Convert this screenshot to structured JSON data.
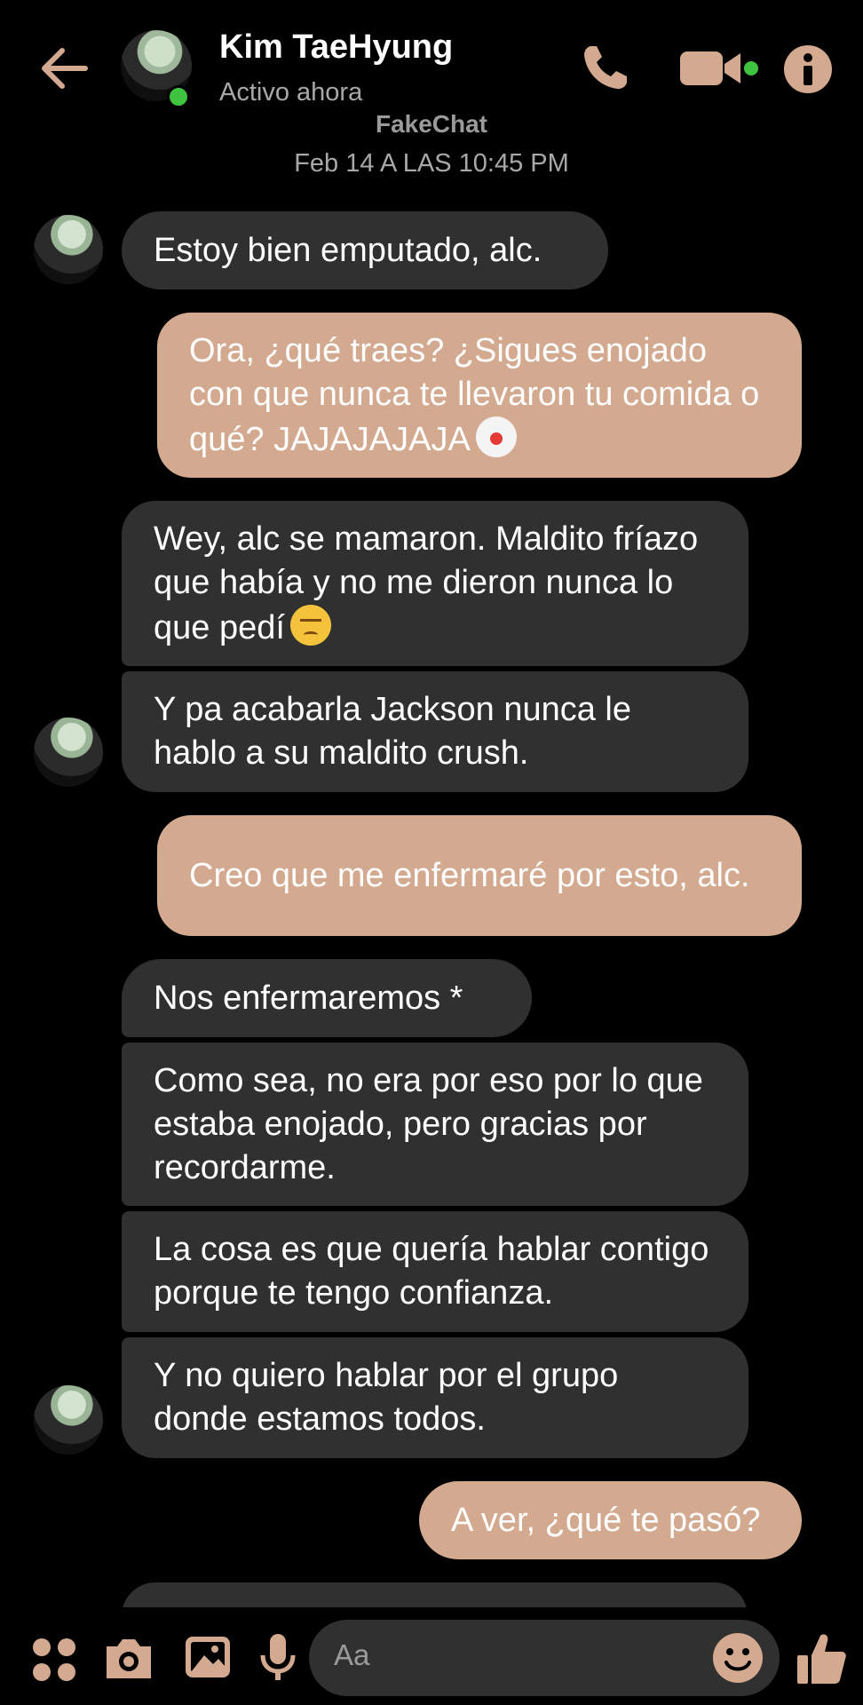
{
  "header": {
    "back_icon": "arrow-left-icon",
    "contact_name": "Kim TaeHyung",
    "status": "Activo ahora",
    "icons": [
      "phone-icon",
      "video-camera-icon",
      "info-icon"
    ]
  },
  "watermark": "FakeChat",
  "timestamp": "Feb 14 A LAS 10:45 PM",
  "messages": [
    {
      "from": "them",
      "text": "Estoy bien emputado, alc."
    },
    {
      "from": "me",
      "text": "Ora, ¿qué traes? ¿Sigues enojado con que nunca te llevaron tu comida o qué? JAJAJAJAJA",
      "emoji": "clown-face"
    },
    {
      "from": "them",
      "text": "Wey, alc se mamaron. Maldito fríazo que había y no me dieron nunca lo que pedí",
      "emoji": "pensive-face"
    },
    {
      "from": "them",
      "text": "Y pa acabarla Jackson nunca le hablo a su maldito crush."
    },
    {
      "from": "me",
      "text": "Creo que me enfermaré por esto, alc."
    },
    {
      "from": "them",
      "text": "Nos enfermaremos *"
    },
    {
      "from": "them",
      "text": "Como sea, no era por eso por lo que estaba enojado, pero gracias por recordarme."
    },
    {
      "from": "them",
      "text": "La cosa es que quería hablar contigo porque te tengo confianza."
    },
    {
      "from": "them",
      "text": "Y no quiero hablar por el grupo donde estamos todos."
    },
    {
      "from": "me",
      "text": "A ver, ¿qué te pasó?"
    }
  ],
  "composer": {
    "placeholder": "Aa",
    "icons": [
      "apps-icon",
      "camera-icon",
      "gallery-icon",
      "microphone-icon",
      "emoji-icon",
      "thumbs-up-icon"
    ]
  },
  "colors": {
    "accent": "#d3a98f",
    "incoming_bubble": "#303030",
    "online": "#3ec43e",
    "background": "#000000"
  }
}
